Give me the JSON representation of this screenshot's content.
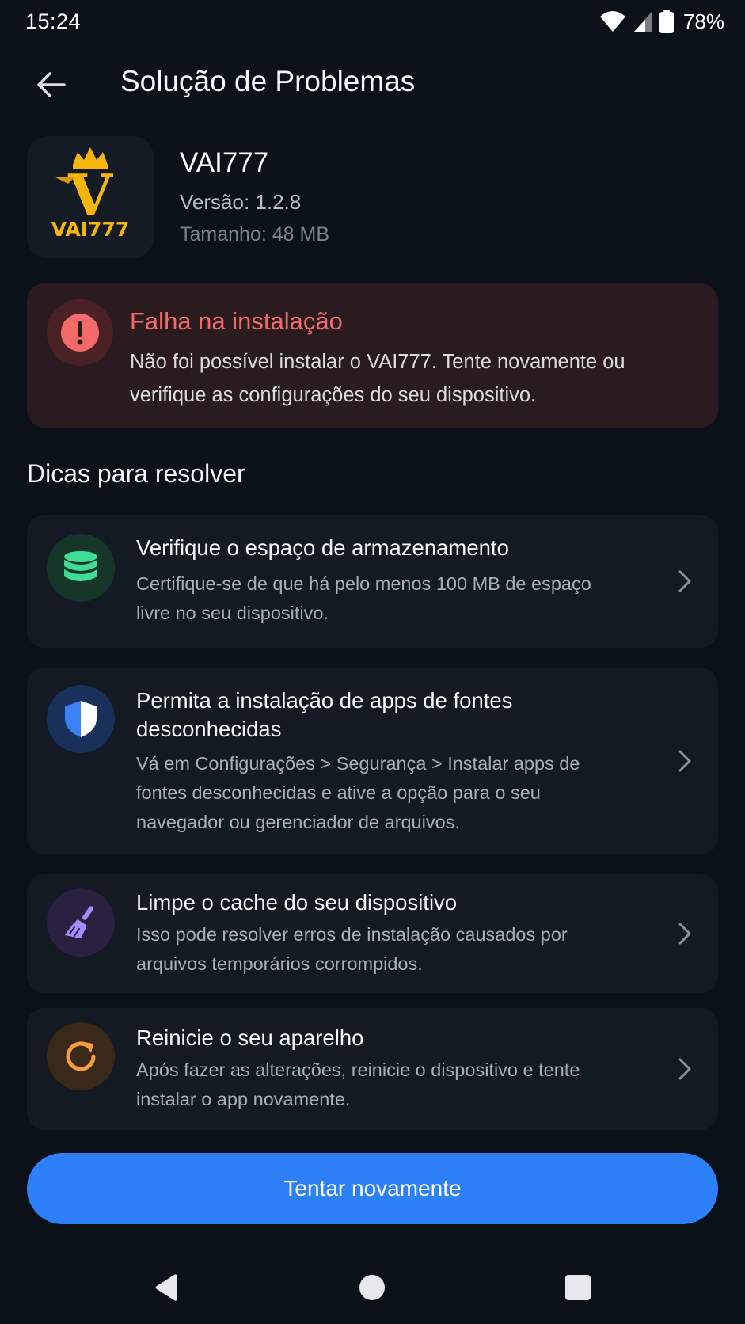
{
  "status_bar": {
    "time": "15:24",
    "battery": "78%"
  },
  "header": {
    "title": "Solução de Problemas"
  },
  "app": {
    "name": "VAI777",
    "version": "Versão: 1.2.8",
    "size": "Tamanho: 48 MB",
    "logo_text": "VAI777",
    "logo_letter": "V"
  },
  "error": {
    "title": "Falha na instalação",
    "description": "Não foi possível instalar o VAI777. Tente novamente ou verifique as configurações do seu dispositivo."
  },
  "tips_section": {
    "title": "Dicas para resolver",
    "items": [
      {
        "title": "Verifique o espaço de armazenamento",
        "description": "Certifique-se de que há pelo menos 100 MB de espaço livre no seu dispositivo.",
        "icon": "database-icon",
        "color": "#3ddc97"
      },
      {
        "title": "Permita a instalação de apps de fontes desconhecidas",
        "description": "Vá em Configurações > Segurança > Instalar apps de fontes desconhecidas e ative a opção para o seu navegador ou gerenciador de arquivos.",
        "icon": "shield-icon",
        "color": "#3b82f6"
      },
      {
        "title": "Limpe o cache do seu dispositivo",
        "description": "Isso pode resolver erros de instalação causados por arquivos temporários corrompidos.",
        "icon": "broom-icon",
        "color": "#a78bfa"
      },
      {
        "title": "Reinicie o seu aparelho",
        "description": "Após fazer as alterações, reinicie o dispositivo e tente instalar o app novamente.",
        "icon": "restart-icon",
        "color": "#f59e3b"
      }
    ]
  },
  "actions": {
    "retry_label": "Tentar novamente"
  },
  "colors": {
    "background": "#0b1119",
    "card": "#131a24",
    "error_card": "#2a1b1e",
    "error_accent": "#f26a6a",
    "primary": "#2d80f7",
    "logo_gold": "#f5b50a"
  }
}
